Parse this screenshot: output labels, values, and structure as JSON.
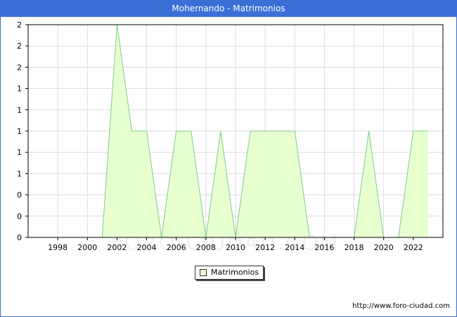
{
  "title": "Mohernando - Matrimonios",
  "source_url": "http://www.foro-ciudad.com",
  "watermark": "FORO-CIUDAD.COM",
  "colors": {
    "titlebar": "#3b6fd6",
    "fill": "#e8ffd0",
    "line": "#7fcc8a",
    "grid": "#dddddd"
  },
  "chart_data": {
    "type": "area",
    "title": "Mohernando - Matrimonios",
    "xlabel": "",
    "ylabel": "",
    "grid": true,
    "legend_position": "bottom-center",
    "x_ticks": [
      1998,
      2000,
      2002,
      2004,
      2006,
      2008,
      2010,
      2012,
      2014,
      2016,
      2018,
      2020,
      2022
    ],
    "y_tick_labels": [
      "0",
      "0",
      "0",
      "1",
      "1",
      "1",
      "1",
      "1",
      "2",
      "2",
      "2"
    ],
    "xlim": [
      1996,
      2024
    ],
    "ylim": [
      0,
      2
    ],
    "series": [
      {
        "name": "Matrimonios",
        "x": [
          1997,
          1998,
          1999,
          2000,
          2001,
          2002,
          2003,
          2004,
          2005,
          2006,
          2007,
          2008,
          2009,
          2010,
          2011,
          2012,
          2013,
          2014,
          2015,
          2016,
          2017,
          2018,
          2019,
          2020,
          2021,
          2022,
          2023
        ],
        "values": [
          0,
          0,
          0,
          0,
          0,
          2,
          1,
          1,
          0,
          1,
          1,
          0,
          1,
          0,
          1,
          1,
          1,
          1,
          0,
          0,
          0,
          0,
          1,
          0,
          0,
          1,
          1
        ]
      }
    ]
  }
}
